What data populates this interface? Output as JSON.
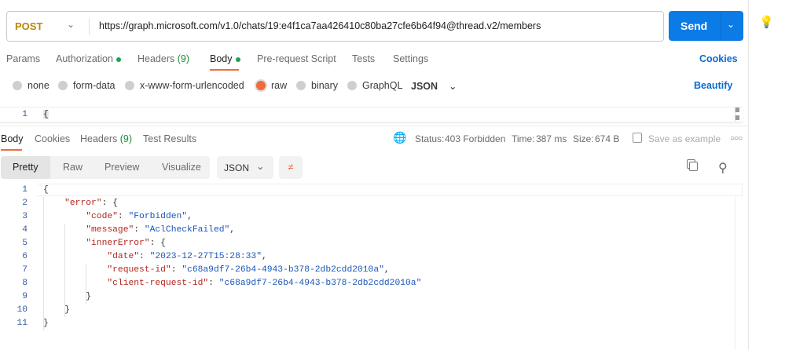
{
  "request": {
    "method": "POST",
    "url": "https://graph.microsoft.com/v1.0/chats/19:e4f1ca7aa426410c80ba27cfe6b64f94@thread.v2/members",
    "send_label": "Send"
  },
  "req_tabs": [
    {
      "label": "Params"
    },
    {
      "label": "Authorization"
    },
    {
      "label": "Headers",
      "count": "(9)"
    },
    {
      "label": "Body"
    },
    {
      "label": "Pre-request Script"
    },
    {
      "label": "Tests"
    },
    {
      "label": "Settings"
    }
  ],
  "cookies_label": "Cookies",
  "body_types": [
    "none",
    "form-data",
    "x-www-form-urlencoded",
    "raw",
    "binary",
    "GraphQL"
  ],
  "body_format": "JSON",
  "beautify_label": "Beautify",
  "request_editor": {
    "line": "1",
    "text": "{"
  },
  "resp_tabs": [
    {
      "label": "Body"
    },
    {
      "label": "Cookies"
    },
    {
      "label": "Headers",
      "count": "(9)"
    },
    {
      "label": "Test Results"
    }
  ],
  "status": {
    "status_label": "Status:",
    "status_value": "403 Forbidden",
    "time_label": "Time:",
    "time_value": "387 ms",
    "size_label": "Size:",
    "size_value": "674 B",
    "save_label": "Save as example"
  },
  "view_modes": [
    "Pretty",
    "Raw",
    "Preview",
    "Visualize"
  ],
  "resp_format": "JSON",
  "colors": {
    "accent": "#f26b3a",
    "send": "#0b7be6",
    "green": "#1f8a3a"
  }
}
